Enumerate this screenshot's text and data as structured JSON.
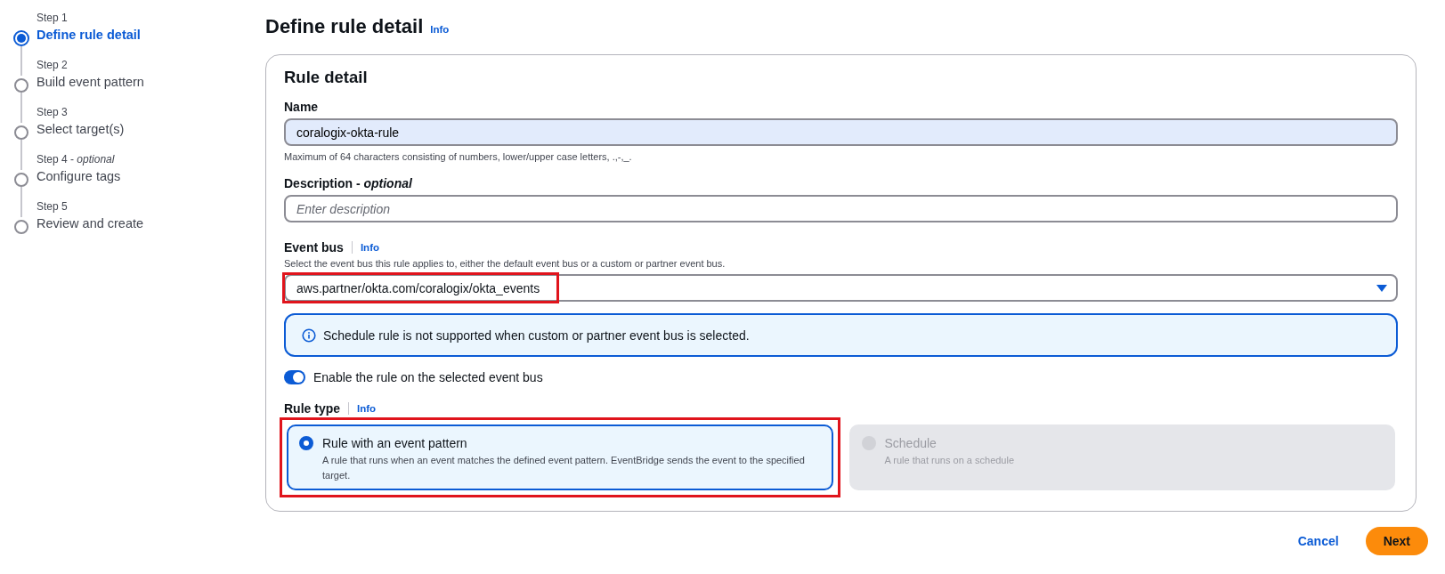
{
  "steps": [
    {
      "step": "Step 1",
      "label": "Define rule detail",
      "selected": true
    },
    {
      "step": "Step 2",
      "label": "Build event pattern",
      "selected": false
    },
    {
      "step": "Step 3",
      "label": "Select target(s)",
      "selected": false
    },
    {
      "step": "Step 4 - *optional*",
      "label": "Configure tags",
      "selected": false
    },
    {
      "step": "Step 5",
      "label": "Review and create",
      "selected": false
    }
  ],
  "page": {
    "title": "Define rule detail",
    "info": "Info"
  },
  "card": {
    "title": "Rule detail",
    "name": {
      "label": "Name",
      "value": "coralogix-okta-rule",
      "hint": "Maximum of 64 characters consisting of numbers, lower/upper case letters, .,-,_."
    },
    "description": {
      "label": "Description - *optional*",
      "placeholder": "Enter description"
    },
    "event_bus": {
      "label": "Event bus",
      "info": "Info",
      "hint": "Select the event bus this rule applies to, either the default event bus or a custom or partner event bus.",
      "value": "aws.partner/okta.com/coralogix/okta_events",
      "highlighted": true
    },
    "alert": {
      "text": "Schedule rule is not supported when custom or partner event bus is selected."
    },
    "toggle": {
      "label": "Enable the rule on the selected event bus",
      "on": true
    },
    "rule_type": {
      "label": "Rule type",
      "info": "Info",
      "options": [
        {
          "label": "Rule with an event pattern",
          "description": "A rule that runs when an event matches the defined event pattern. EventBridge sends the event to the specified target.",
          "selected": true,
          "disabled": false,
          "highlighted": true
        },
        {
          "label": "Schedule",
          "description": "A rule that runs on a schedule",
          "selected": false,
          "disabled": true,
          "highlighted": false
        }
      ]
    }
  },
  "actions": {
    "cancel": "Cancel",
    "next": "Next"
  }
}
